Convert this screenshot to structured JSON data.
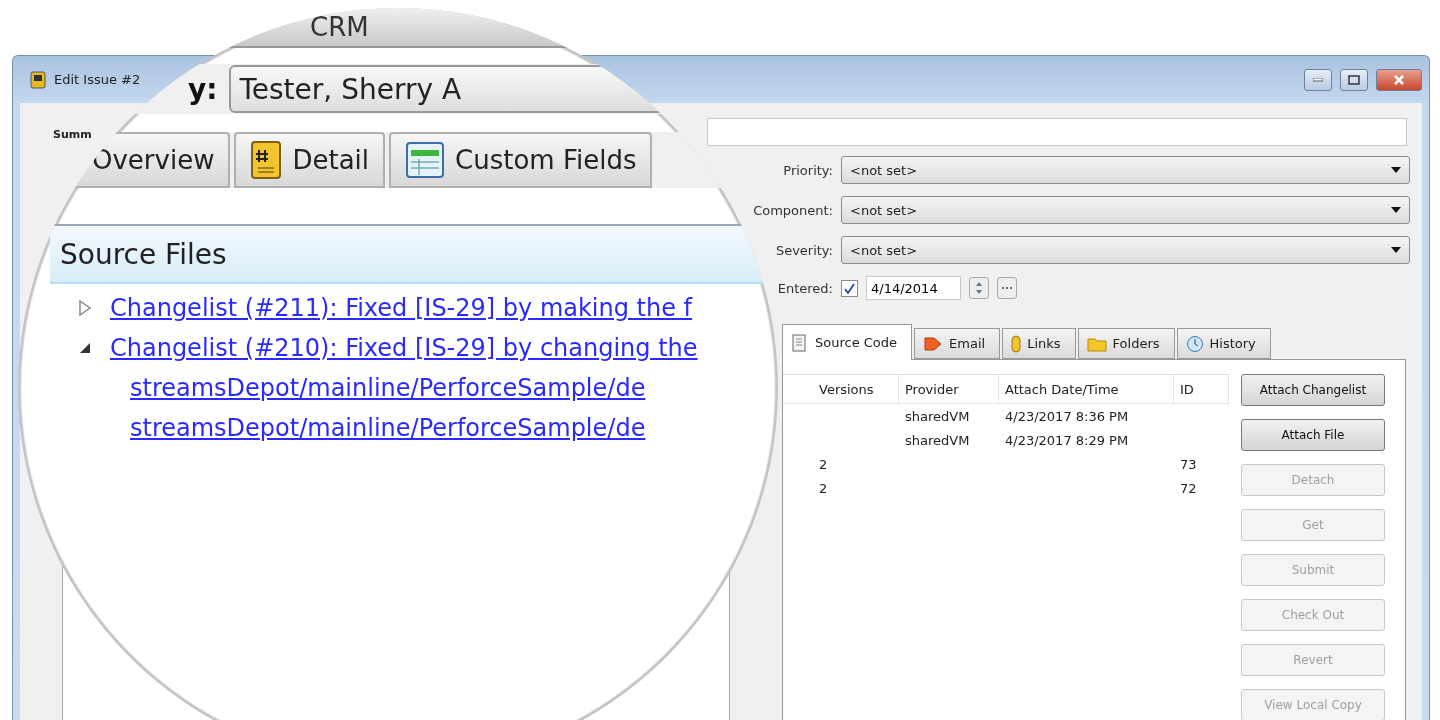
{
  "window": {
    "title": "Edit Issue #2"
  },
  "summary": {
    "label": "Summ"
  },
  "fields": [
    {
      "label": "Priority:",
      "value": "<not set>"
    },
    {
      "label": "Component:",
      "value": "<not set>"
    },
    {
      "label": "Severity:",
      "value": "<not set>"
    }
  ],
  "entered": {
    "label": "Entered:",
    "checked": true,
    "value": "4/14/2014"
  },
  "tabs": [
    {
      "label": "Source Code",
      "selected": true
    },
    {
      "label": "Email",
      "selected": false
    },
    {
      "label": "Links",
      "selected": false
    },
    {
      "label": "Folders",
      "selected": false
    },
    {
      "label": "History",
      "selected": false
    }
  ],
  "table": {
    "columns": [
      "Versions",
      "Provider",
      "Attach Date/Time",
      "ID"
    ],
    "rows": [
      [
        "",
        "sharedVM",
        "4/23/2017 8:36 PM",
        ""
      ],
      [
        "",
        "sharedVM",
        "4/23/2017 8:29 PM",
        ""
      ],
      [
        "2",
        "",
        "",
        "73"
      ],
      [
        "2",
        "",
        "",
        "72"
      ]
    ]
  },
  "buttons": [
    {
      "label": "Attach Changelist",
      "disabled": false
    },
    {
      "label": "Attach File",
      "disabled": false
    },
    {
      "label": "Detach",
      "disabled": true
    },
    {
      "label": "Get",
      "disabled": true
    },
    {
      "label": "Submit",
      "disabled": true
    },
    {
      "label": "Check Out",
      "disabled": true
    },
    {
      "label": "Revert",
      "disabled": true
    },
    {
      "label": "View Local Copy",
      "disabled": true
    }
  ],
  "magnifier": {
    "top_tab": "CRM",
    "field_label": "y:",
    "field_value": "Tester, Sherry A",
    "tabs": [
      {
        "label": "Overview"
      },
      {
        "label": "Detail"
      },
      {
        "label": "Custom Fields"
      }
    ],
    "panel_title": "Source Files",
    "tree": [
      {
        "label": "Changelist (#211): Fixed [IS-29] by making the f",
        "expanded": false
      },
      {
        "label": "Changelist (#210): Fixed [IS-29] by changing the",
        "expanded": true,
        "children": [
          {
            "label": "streamsDepot/mainline/PerforceSample/de"
          },
          {
            "label": "streamsDepot/mainline/PerforceSample/de"
          }
        ]
      }
    ]
  }
}
